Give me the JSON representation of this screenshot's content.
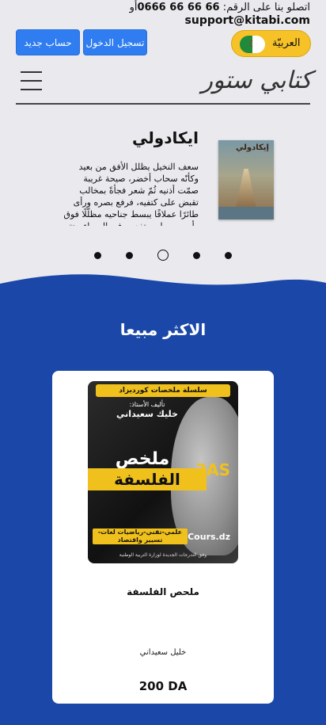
{
  "topbar": {
    "contact_prefix": "اتصلو بنا على الرقم:",
    "phone": "0666 66 66 66",
    "or": "أو",
    "email": "support@kitabi.com"
  },
  "auth": {
    "register_label": "حساب جديد",
    "login_label": "تسجيل الدخول"
  },
  "language": {
    "label": "العربيّة",
    "flag_icon": "algeria-flag-icon"
  },
  "header": {
    "logo": "كتابي ستور",
    "menu_icon": "hamburger-menu-icon"
  },
  "slider": {
    "title": "ايكادولي",
    "cover_title": "إيكادولي",
    "text": "سعف النخيل يظلل الأفق من بعيد وكأنّه سحاب أخضر، صيحة غريبة صمّت أذنيه ثُمّ شعر فجأةً بمخالب تقبض على كتفيه، فرفع بصره ورأى طائرًا عملاقًا يبسط جناحيه مظلّلًا فوق رأسه، وصار يرتفع به في السماء، حتى رأى الأرض من تحته بعيدة",
    "dot_count": 5,
    "active_dot": 3
  },
  "bestsellers": {
    "title": "الاكثر مبيعا",
    "book": {
      "title": "ملحص الفلسفة",
      "author": "خليل سعيداني",
      "price": "200 DA",
      "cover": {
        "series": "سلسلة ملخصات كورديزاد",
        "author_label": "تأليف الأستاذ:",
        "author": "خليك سعيداني",
        "main": "ملخص",
        "badge": "3AS",
        "band": "الفلسفة",
        "tracks": "علمي-تقني-رياضيات لغات-تسيير واقتصاد",
        "brand": "Cours.dz",
        "foot": "وفق التدرجات الجديدة لوزارة التربية الوطنية"
      }
    }
  },
  "colors": {
    "accent_blue": "#1b48a8",
    "button_blue": "#2f7df1",
    "lang_yellow": "#f6c228"
  }
}
